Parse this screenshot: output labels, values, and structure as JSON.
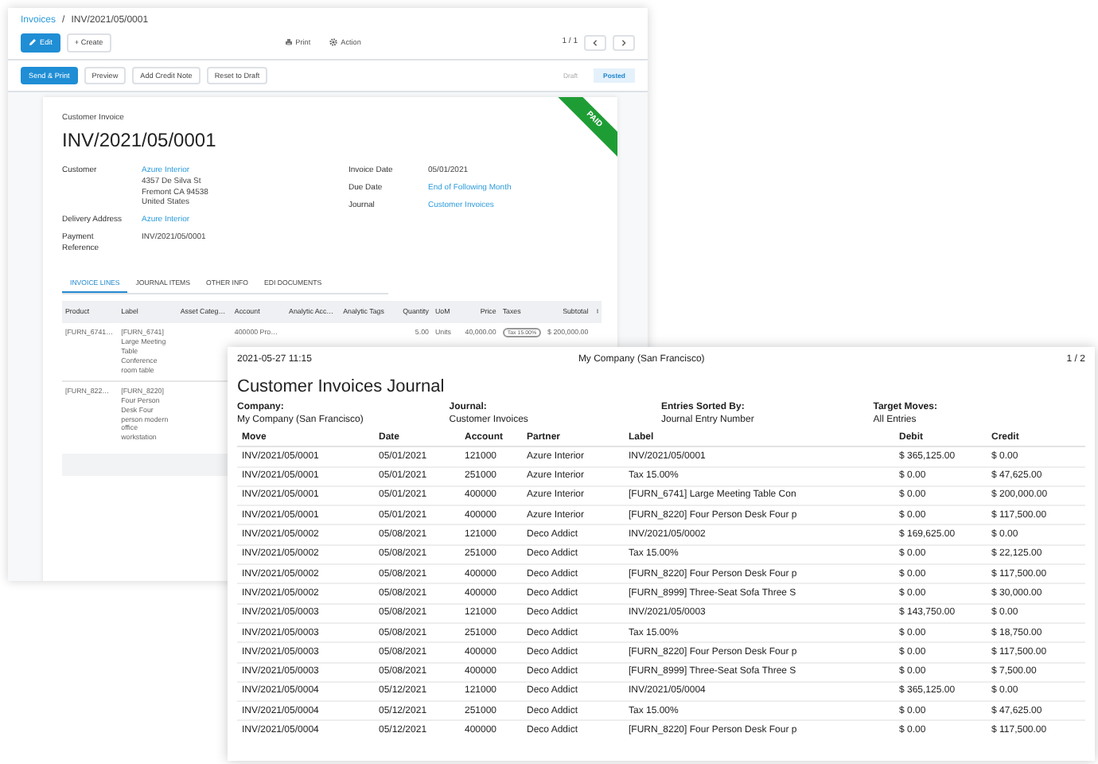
{
  "invoice_window": {
    "breadcrumb": {
      "parent": "Invoices",
      "separator": "/",
      "current": "INV/2021/05/0001"
    },
    "toolbar": {
      "edit": "Edit",
      "create": "+ Create",
      "print": "Print",
      "action": "Action",
      "pager": "1 / 1"
    },
    "actions": [
      {
        "label": "Send & Print",
        "primary": true
      },
      {
        "label": "Preview",
        "primary": false
      },
      {
        "label": "Add Credit Note",
        "primary": false
      },
      {
        "label": "Reset to Draft",
        "primary": false
      }
    ],
    "status": [
      {
        "label": "Draft",
        "selected": false
      },
      {
        "label": "Posted",
        "selected": true
      }
    ],
    "ribbon": "PAID",
    "doc_type": "Customer Invoice",
    "number": "INV/2021/05/0001",
    "fields_left": [
      {
        "label": "Customer",
        "value": "Azure Interior",
        "link": true,
        "extra_lines": [
          "4357 De Silva St",
          "Fremont CA 94538",
          "United States"
        ]
      },
      {
        "label": "Delivery Address",
        "value": "Azure Interior",
        "link": true
      },
      {
        "label": "Payment Reference",
        "value": "INV/2021/05/0001",
        "link": false
      }
    ],
    "fields_right": [
      {
        "label": "Invoice Date",
        "value": "05/01/2021",
        "link": false
      },
      {
        "label": "Due Date",
        "value": "End of Following Month",
        "link": true
      },
      {
        "label": "Journal",
        "value": "Customer Invoices",
        "link": true
      }
    ],
    "tabs": [
      {
        "label": "INVOICE LINES",
        "selected": true
      },
      {
        "label": "JOURNAL ITEMS",
        "selected": false
      },
      {
        "label": "OTHER INFO",
        "selected": false
      },
      {
        "label": "EDI DOCUMENTS",
        "selected": false
      }
    ],
    "lines": {
      "columns": [
        "Product",
        "Label",
        "Asset Categ…",
        "Account",
        "Analytic Acc…",
        "Analytic Tags",
        "Quantity",
        "UoM",
        "Price",
        "Taxes",
        "Subtotal"
      ],
      "rows": [
        {
          "product": "[FURN_6741…",
          "label": "[FURN_6741] Large Meeting Table Conference room table",
          "account": "400000 Pro…",
          "quantity": "5.00",
          "uom": "Units",
          "price": "40,000.00",
          "taxes": "Tax 15.00%",
          "subtotal": "$ 200,000.00"
        },
        {
          "product": "[FURN_822…",
          "label": "[FURN_8220] Four Person Desk Four person modern office workstation"
        }
      ]
    }
  },
  "report": {
    "printed_at": "2021-05-27 11:15",
    "company": "My Company (San Francisco)",
    "page": "1 / 2",
    "title": "Customer Invoices Journal",
    "info": [
      {
        "label": "Company:",
        "value": "My Company (San Francisco)"
      },
      {
        "label": "Journal:",
        "value": "Customer Invoices"
      },
      {
        "label": "Entries Sorted By:",
        "value": "Journal Entry Number"
      },
      {
        "label": "Target Moves:",
        "value": "All Entries"
      }
    ],
    "columns": [
      "Move",
      "Date",
      "Account",
      "Partner",
      "Label",
      "Debit",
      "Credit"
    ],
    "rows": [
      [
        "INV/2021/05/0001",
        "05/01/2021",
        "121000",
        "Azure Interior",
        "INV/2021/05/0001",
        "$ 365,125.00",
        "$ 0.00"
      ],
      [
        "INV/2021/05/0001",
        "05/01/2021",
        "251000",
        "Azure Interior",
        "Tax 15.00%",
        "$ 0.00",
        "$ 47,625.00"
      ],
      [
        "INV/2021/05/0001",
        "05/01/2021",
        "400000",
        "Azure Interior",
        "[FURN_6741] Large Meeting Table Con",
        "$ 0.00",
        "$ 200,000.00"
      ],
      [
        "INV/2021/05/0001",
        "05/01/2021",
        "400000",
        "Azure Interior",
        "[FURN_8220] Four Person Desk Four p",
        "$ 0.00",
        "$ 117,500.00"
      ],
      [
        "INV/2021/05/0002",
        "05/08/2021",
        "121000",
        "Deco Addict",
        "INV/2021/05/0002",
        "$ 169,625.00",
        "$ 0.00"
      ],
      [
        "INV/2021/05/0002",
        "05/08/2021",
        "251000",
        "Deco Addict",
        "Tax 15.00%",
        "$ 0.00",
        "$ 22,125.00"
      ],
      [
        "INV/2021/05/0002",
        "05/08/2021",
        "400000",
        "Deco Addict",
        "[FURN_8220] Four Person Desk Four p",
        "$ 0.00",
        "$ 117,500.00"
      ],
      [
        "INV/2021/05/0002",
        "05/08/2021",
        "400000",
        "Deco Addict",
        "[FURN_8999] Three-Seat Sofa Three S",
        "$ 0.00",
        "$ 30,000.00"
      ],
      [
        "INV/2021/05/0003",
        "05/08/2021",
        "121000",
        "Deco Addict",
        "INV/2021/05/0003",
        "$ 143,750.00",
        "$ 0.00"
      ],
      [
        "INV/2021/05/0003",
        "05/08/2021",
        "251000",
        "Deco Addict",
        "Tax 15.00%",
        "$ 0.00",
        "$ 18,750.00"
      ],
      [
        "INV/2021/05/0003",
        "05/08/2021",
        "400000",
        "Deco Addict",
        "[FURN_8220] Four Person Desk Four p",
        "$ 0.00",
        "$ 117,500.00"
      ],
      [
        "INV/2021/05/0003",
        "05/08/2021",
        "400000",
        "Deco Addict",
        "[FURN_8999] Three-Seat Sofa Three S",
        "$ 0.00",
        "$ 7,500.00"
      ],
      [
        "INV/2021/05/0004",
        "05/12/2021",
        "121000",
        "Deco Addict",
        "INV/2021/05/0004",
        "$ 365,125.00",
        "$ 0.00"
      ],
      [
        "INV/2021/05/0004",
        "05/12/2021",
        "251000",
        "Deco Addict",
        "Tax 15.00%",
        "$ 0.00",
        "$ 47,625.00"
      ],
      [
        "INV/2021/05/0004",
        "05/12/2021",
        "400000",
        "Deco Addict",
        "[FURN_8220] Four Person Desk Four p",
        "$ 0.00",
        "$ 117,500.00"
      ]
    ]
  }
}
